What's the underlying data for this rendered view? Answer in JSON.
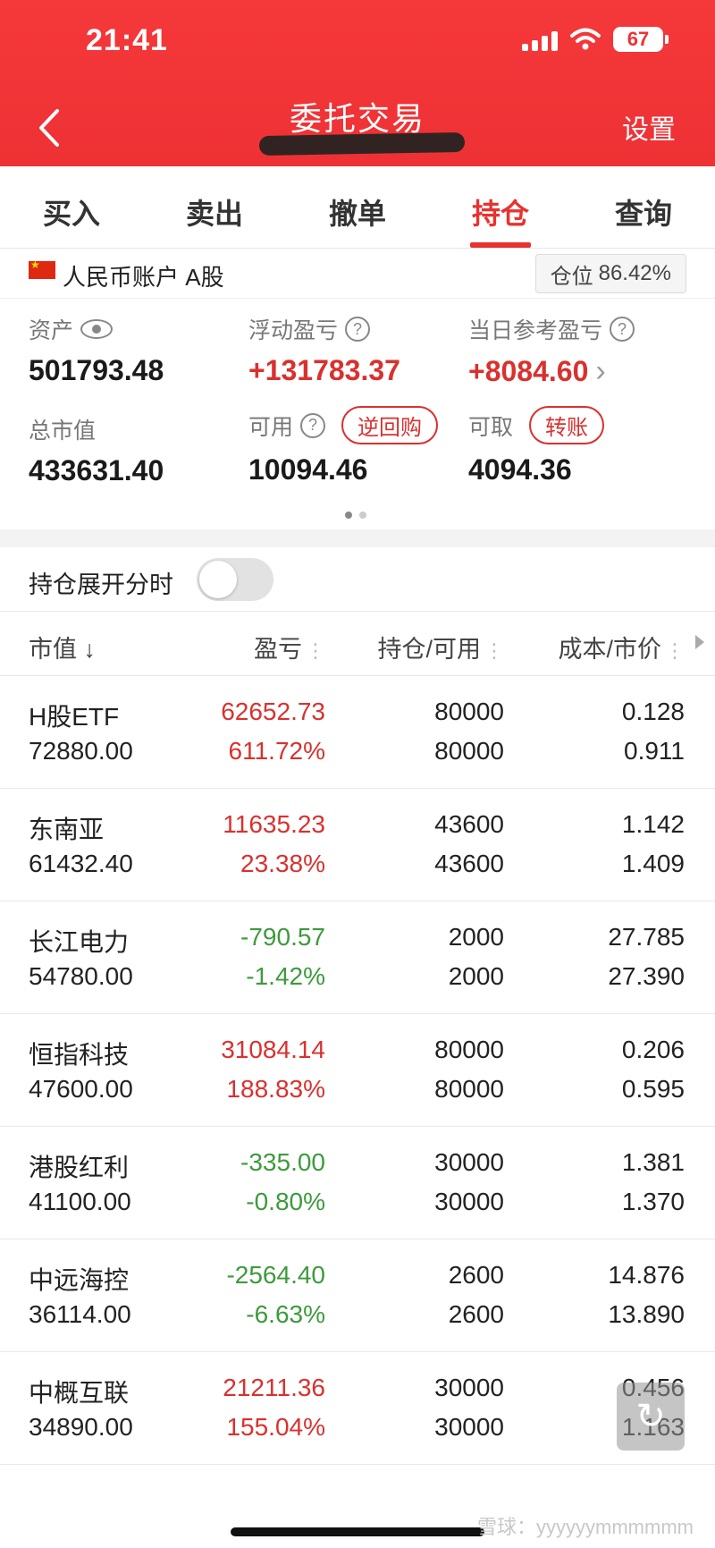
{
  "status_bar": {
    "time": "21:41",
    "battery": "67"
  },
  "header": {
    "title": "委托交易",
    "settings_label": "设置"
  },
  "tabs": [
    {
      "label": "买入",
      "active": false
    },
    {
      "label": "卖出",
      "active": false
    },
    {
      "label": "撤单",
      "active": false
    },
    {
      "label": "持仓",
      "active": true
    },
    {
      "label": "查询",
      "active": false
    }
  ],
  "account": {
    "label": "人民币账户  A股",
    "position_label": "仓位",
    "position_value": "86.42%"
  },
  "summary": {
    "assets": {
      "label": "资产",
      "value": "501793.48"
    },
    "floating_pnl": {
      "label": "浮动盈亏",
      "value": "+131783.37"
    },
    "daily_pnl": {
      "label": "当日参考盈亏",
      "value": "+8084.60"
    },
    "market_value": {
      "label": "总市值",
      "value": "433631.40"
    },
    "available": {
      "label": "可用",
      "value": "10094.46",
      "button": "逆回购"
    },
    "withdrawable": {
      "label": "可取",
      "value": "4094.36",
      "button": "转账"
    }
  },
  "toggle": {
    "label": "持仓展开分时",
    "on": false
  },
  "columns": {
    "market_value": "市值",
    "pnl": "盈亏",
    "hold_avail": "持仓/可用",
    "cost_price": "成本/市价"
  },
  "holdings": [
    {
      "name": "H股ETF",
      "market_value": "72880.00",
      "pnl": "62652.73",
      "pnl_pct": "611.72%",
      "hold": "80000",
      "avail": "80000",
      "cost": "0.128",
      "price": "0.911",
      "sign": "up"
    },
    {
      "name": "东南亚",
      "market_value": "61432.40",
      "pnl": "11635.23",
      "pnl_pct": "23.38%",
      "hold": "43600",
      "avail": "43600",
      "cost": "1.142",
      "price": "1.409",
      "sign": "up"
    },
    {
      "name": "长江电力",
      "market_value": "54780.00",
      "pnl": "-790.57",
      "pnl_pct": "-1.42%",
      "hold": "2000",
      "avail": "2000",
      "cost": "27.785",
      "price": "27.390",
      "sign": "down"
    },
    {
      "name": "恒指科技",
      "market_value": "47600.00",
      "pnl": "31084.14",
      "pnl_pct": "188.83%",
      "hold": "80000",
      "avail": "80000",
      "cost": "0.206",
      "price": "0.595",
      "sign": "up"
    },
    {
      "name": "港股红利",
      "market_value": "41100.00",
      "pnl": "-335.00",
      "pnl_pct": "-0.80%",
      "hold": "30000",
      "avail": "30000",
      "cost": "1.381",
      "price": "1.370",
      "sign": "down"
    },
    {
      "name": "中远海控",
      "market_value": "36114.00",
      "pnl": "-2564.40",
      "pnl_pct": "-6.63%",
      "hold": "2600",
      "avail": "2600",
      "cost": "14.876",
      "price": "13.890",
      "sign": "down"
    },
    {
      "name": "中概互联",
      "market_value": "34890.00",
      "pnl": "21211.36",
      "pnl_pct": "155.04%",
      "hold": "30000",
      "avail": "30000",
      "cost": "0.456",
      "price": "1.163",
      "sign": "up"
    }
  ],
  "watermark": "雪球：yyyyyymmmmmm",
  "colors": {
    "header": "#ee3134",
    "up": "#d9312e",
    "down": "#3d9a3d"
  }
}
